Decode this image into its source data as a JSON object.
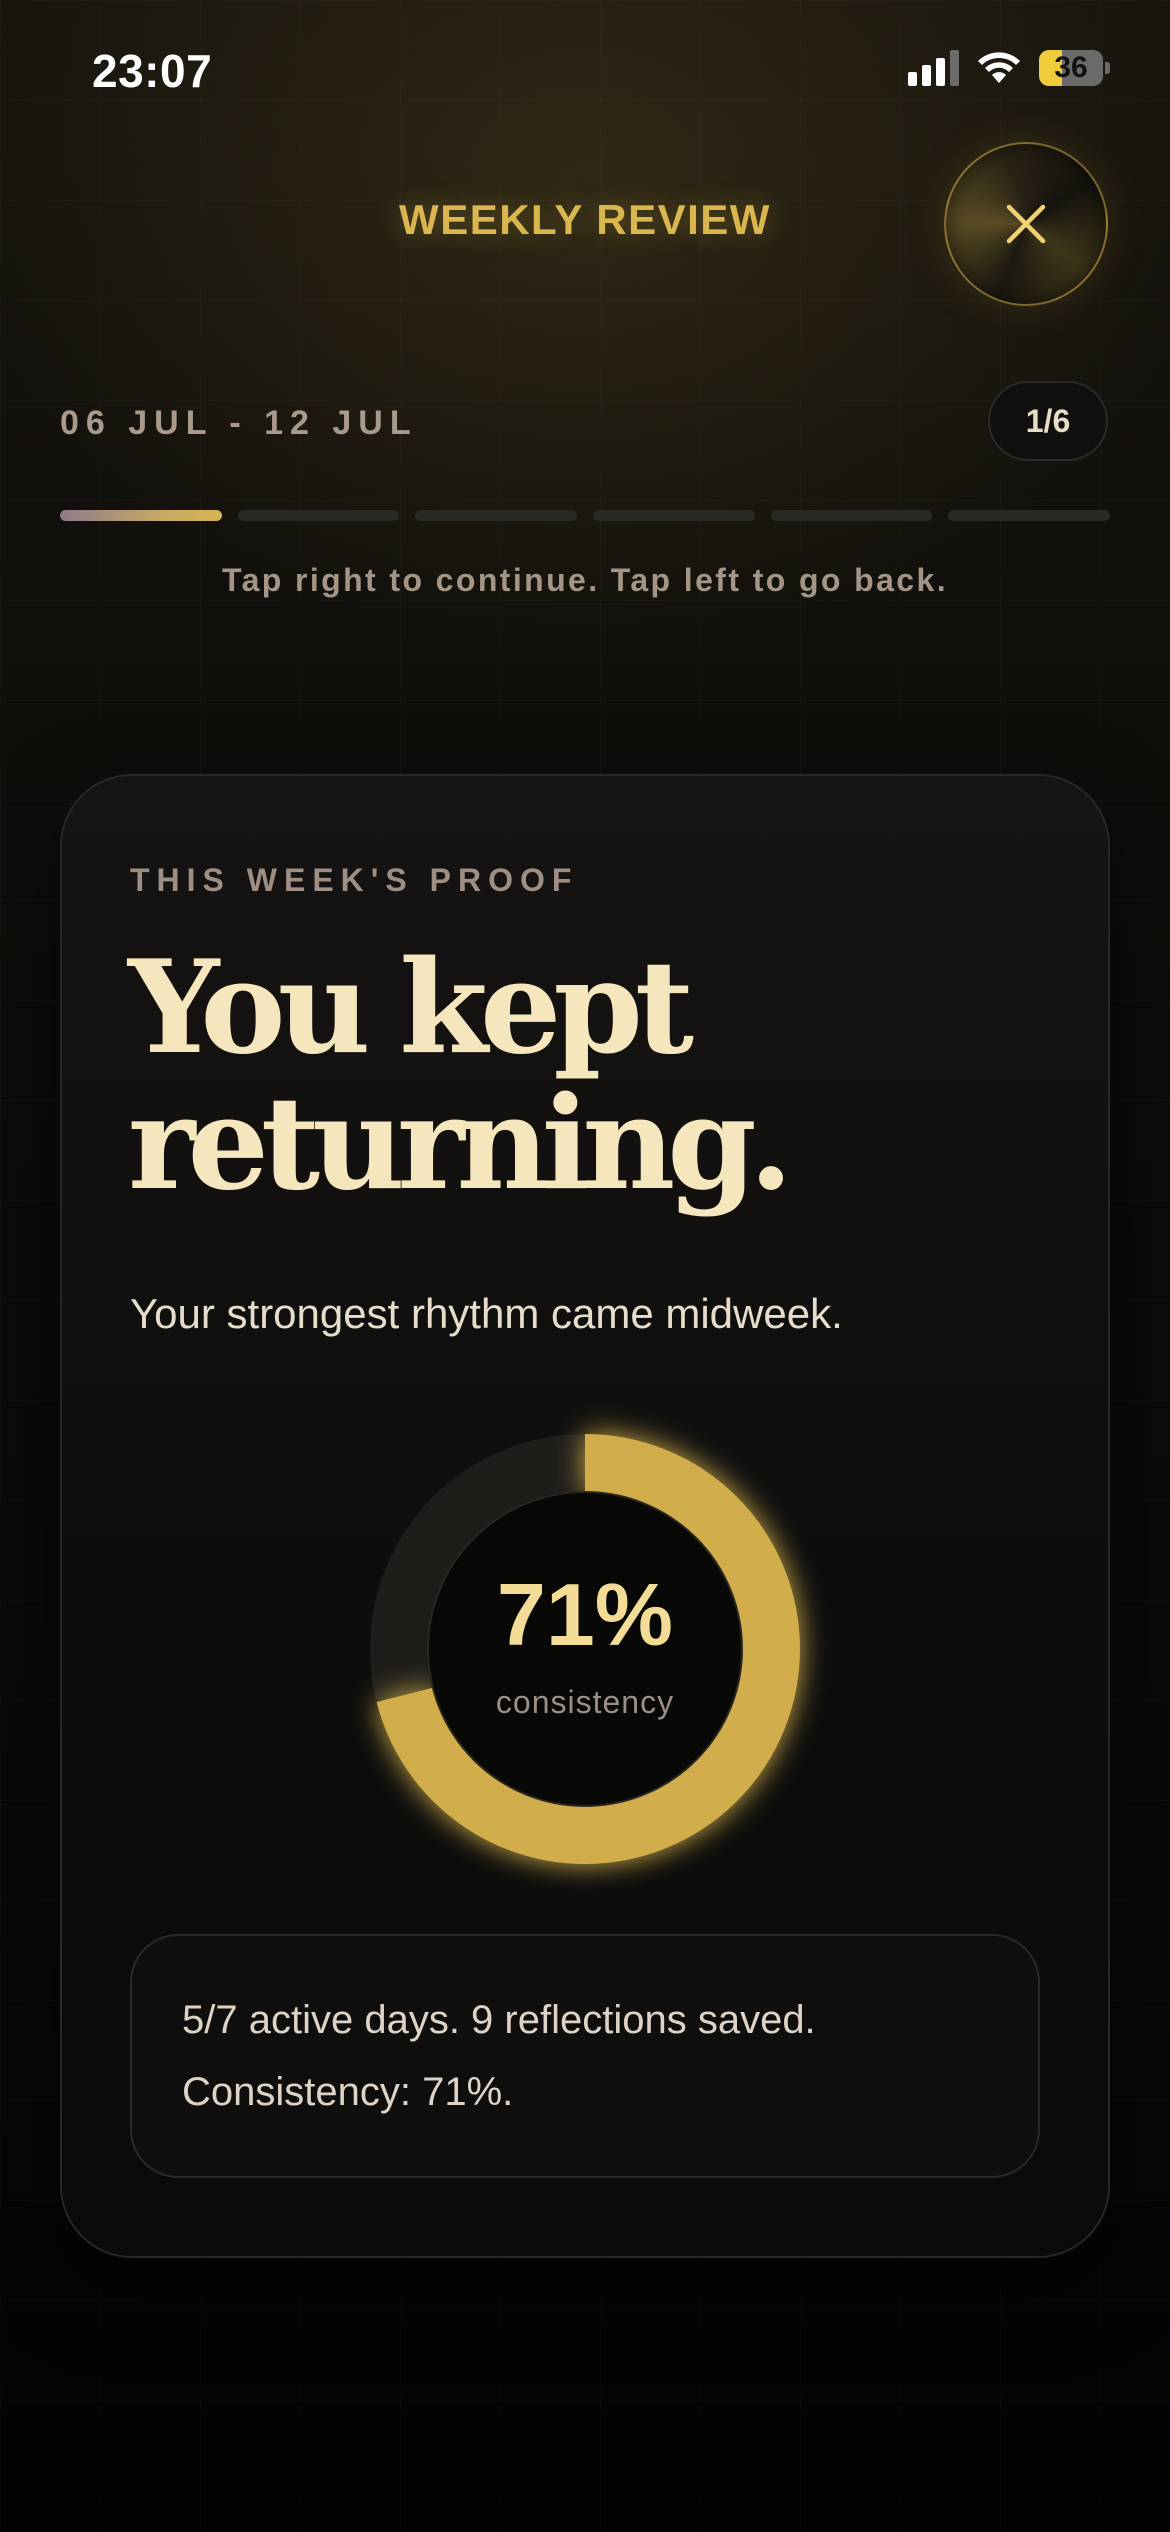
{
  "status_bar": {
    "time": "23:07",
    "battery": "36",
    "battery_level": 0.36,
    "icons": [
      "signal-icon",
      "wifi-icon",
      "battery-icon"
    ]
  },
  "header": {
    "title": "WEEKLY REVIEW",
    "close_icon": "close-icon"
  },
  "review": {
    "date_range": "06 JUL - 12 JUL",
    "page_indicator": "1/6",
    "progress": {
      "total_segments": 6,
      "current": 1
    },
    "hint": "Tap right to continue. Tap left to go back."
  },
  "card": {
    "eyebrow": "THIS WEEK'S PROOF",
    "headline_line1": "You kept",
    "headline_line2": "returning.",
    "subtitle": "Your strongest rhythm came midweek.",
    "ring": {
      "value_text": "71%",
      "label": "consistency",
      "fraction": 0.71
    },
    "stats_line1": "5/7 active days. 9 reflections saved.",
    "stats_line2": "Consistency: 71%."
  },
  "colors": {
    "accent_gold": "#d9b64e",
    "ring_gold": "#d1ae4c",
    "ring_track": "#1f1d1a",
    "headline": "#f5e6bd",
    "background": "#0d0c0a"
  }
}
